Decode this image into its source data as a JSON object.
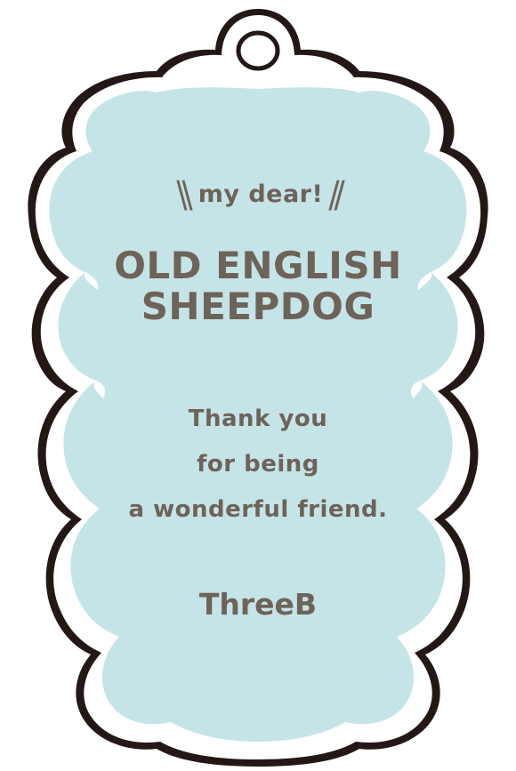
{
  "tag": {
    "greeting_open": "\\\\",
    "greeting": "my dear!",
    "greeting_close": "//",
    "title_line1": "OLD ENGLISH",
    "title_line2": "SHEEPDOG",
    "message_line1": "Thank you",
    "message_line2": "for being",
    "message_line3": "a wonderful friend.",
    "signature": "ThreeB"
  },
  "colors": {
    "fill": "#c5e4e7",
    "outline": "#231815",
    "text": "#6e6359",
    "border": "#ffffff"
  }
}
